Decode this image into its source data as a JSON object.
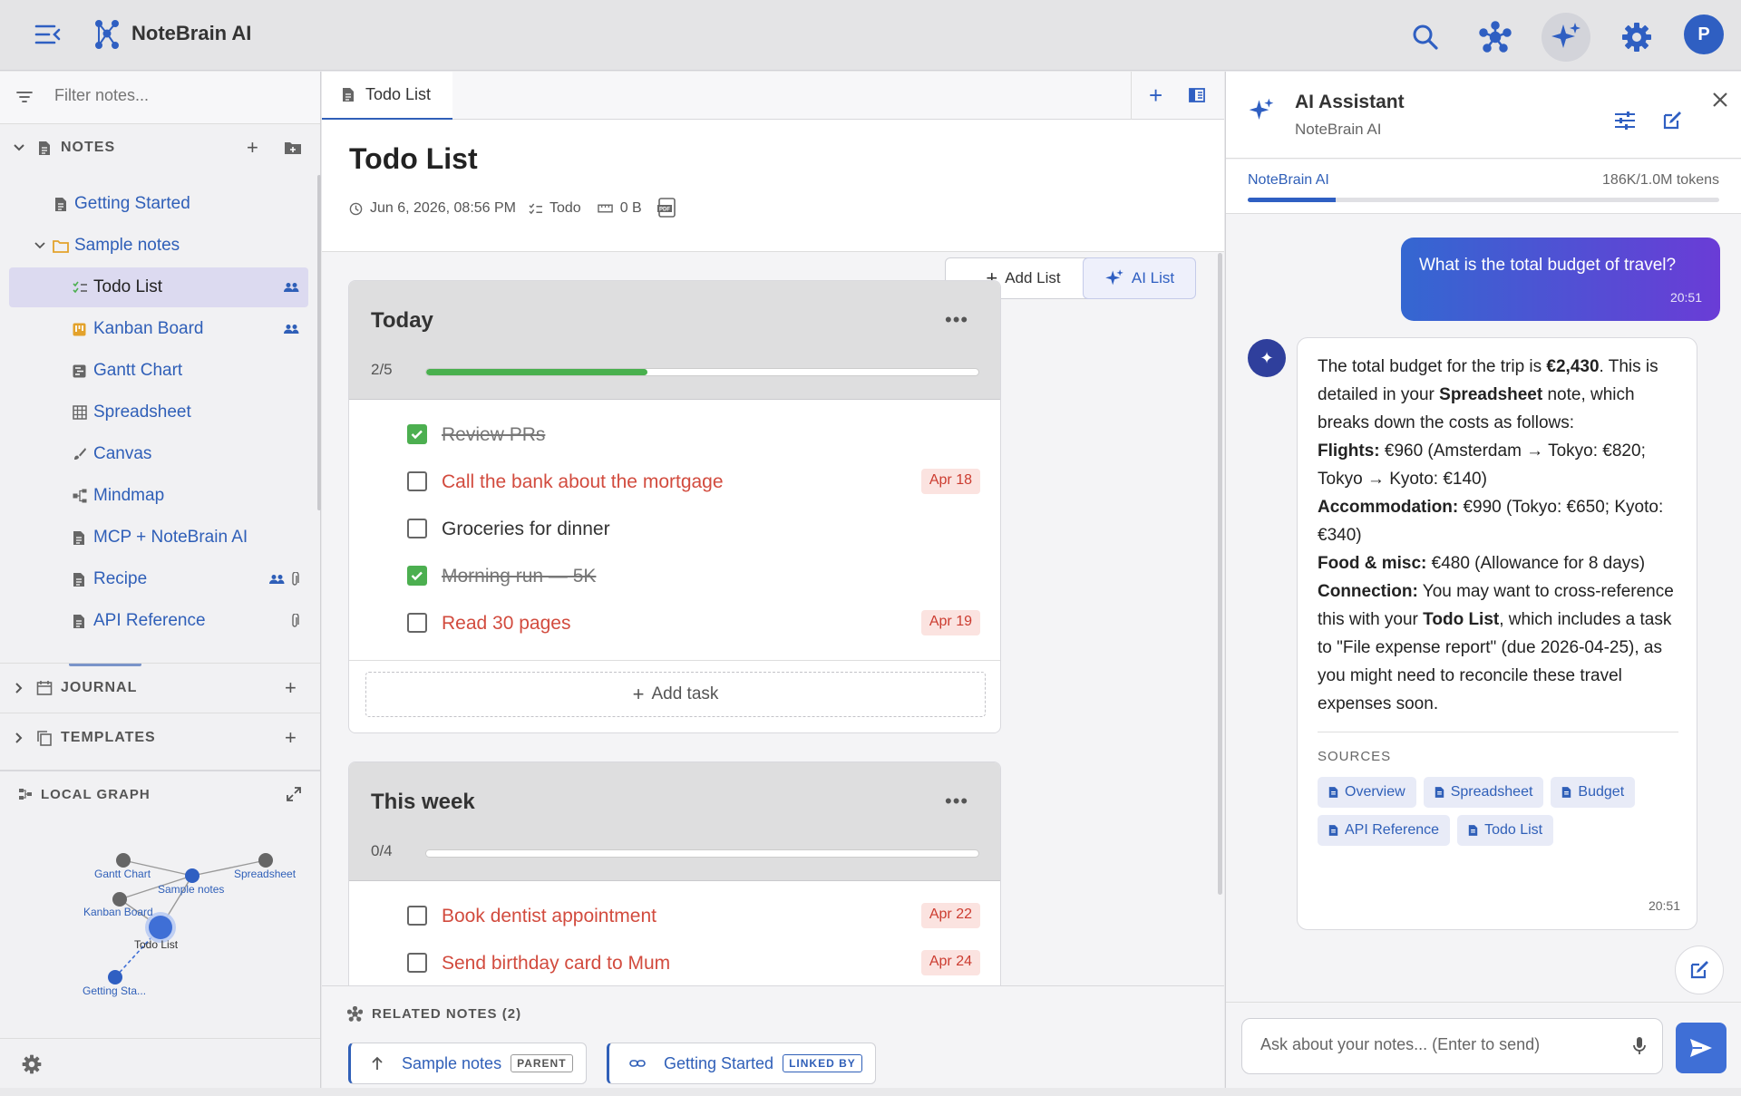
{
  "app": {
    "title": "NoteBrain AI",
    "user_initial": "P"
  },
  "sidebar": {
    "filter_placeholder": "Filter notes...",
    "notes_section": "NOTES",
    "tree": [
      {
        "label": "Getting Started",
        "icon": "document-icon"
      },
      {
        "label": "Sample notes",
        "icon": "folder-icon"
      },
      {
        "label": "Todo List",
        "icon": "checklist-icon",
        "shared": true
      },
      {
        "label": "Kanban Board",
        "icon": "kanban-icon",
        "shared": true
      },
      {
        "label": "Gantt Chart",
        "icon": "gantt-icon"
      },
      {
        "label": "Spreadsheet",
        "icon": "grid-icon"
      },
      {
        "label": "Canvas",
        "icon": "brush-icon"
      },
      {
        "label": "Mindmap",
        "icon": "mindmap-icon"
      },
      {
        "label": "MCP + NoteBrain AI",
        "icon": "document-icon"
      },
      {
        "label": "Recipe",
        "icon": "document-icon",
        "shared": true,
        "attachment": true
      },
      {
        "label": "API Reference",
        "icon": "document-icon",
        "attachment": true
      }
    ],
    "journal_section": "JOURNAL",
    "templates_section": "TEMPLATES",
    "graph_section": "LOCAL GRAPH",
    "graph_nodes": [
      "Gantt Chart",
      "Sample notes",
      "Spreadsheet",
      "Kanban Board",
      "Todo List",
      "Getting Sta..."
    ]
  },
  "editor": {
    "tab_label": "Todo List",
    "title": "Todo List",
    "date": "Jun 6, 2026, 08:56 PM",
    "type": "Todo",
    "size": "0 B",
    "add_list": "Add List",
    "ai_list": "AI List",
    "lists": [
      {
        "name": "Today",
        "progress_text": "2/5",
        "progress": 0.4,
        "tasks": [
          {
            "text": "Review PRs",
            "done": true,
            "due": ""
          },
          {
            "text": "Call the bank about the mortgage",
            "done": false,
            "due": "Apr 18"
          },
          {
            "text": "Groceries for dinner",
            "done": false,
            "due": ""
          },
          {
            "text": "Morning run — 5K",
            "done": true,
            "due": ""
          },
          {
            "text": "Read 30 pages",
            "done": false,
            "due": "Apr 19"
          }
        ],
        "add_task": "Add task"
      },
      {
        "name": "This week",
        "progress_text": "0/4",
        "progress": 0.0,
        "tasks": [
          {
            "text": "Book dentist appointment",
            "done": false,
            "due": "Apr 22"
          },
          {
            "text": "Send birthday card to Mum",
            "done": false,
            "due": "Apr 24"
          }
        ]
      }
    ],
    "related_title": "RELATED NOTES (2)",
    "related": [
      {
        "label": "Sample notes",
        "tag": "PARENT"
      },
      {
        "label": "Getting Started",
        "tag": "LINKED BY"
      }
    ]
  },
  "ai": {
    "title": "AI Assistant",
    "subtitle": "NoteBrain AI",
    "model": "NoteBrain AI",
    "tokens": "186K/1.0M tokens",
    "token_usage": 0.186,
    "user_message": "What is the total budget of travel?",
    "user_time": "20:51",
    "bot": {
      "p1_a": "The total budget for the trip is ",
      "p1_b": "€2,430",
      "p1_c": ". This is detailed in your ",
      "p1_d": "Spreadsheet",
      "p1_e": " note, which breaks down the costs as follows:",
      "flights_k": "Flights:",
      "flights_v": " €960 (Amsterdam → Tokyo: €820; Tokyo → Kyoto: €140)",
      "accom_k": "Accommodation:",
      "accom_v": " €990 (Tokyo: €650; Kyoto: €340)",
      "food_k": "Food & misc:",
      "food_v": " €480 (Allowance for 8 days)",
      "conn_k": "Connection:",
      "conn_a": " You may want to cross-reference this with your ",
      "conn_b": "Todo List",
      "conn_c": ", which includes a task to \"File expense report\" (due 2026-04-25), as you might need to reconcile these travel expenses soon.",
      "sources_title": "SOURCES",
      "sources": [
        "Overview",
        "Spreadsheet",
        "Budget",
        "API Reference",
        "Todo List"
      ],
      "time": "20:51"
    },
    "input_placeholder": "Ask about your notes... (Enter to send)"
  }
}
